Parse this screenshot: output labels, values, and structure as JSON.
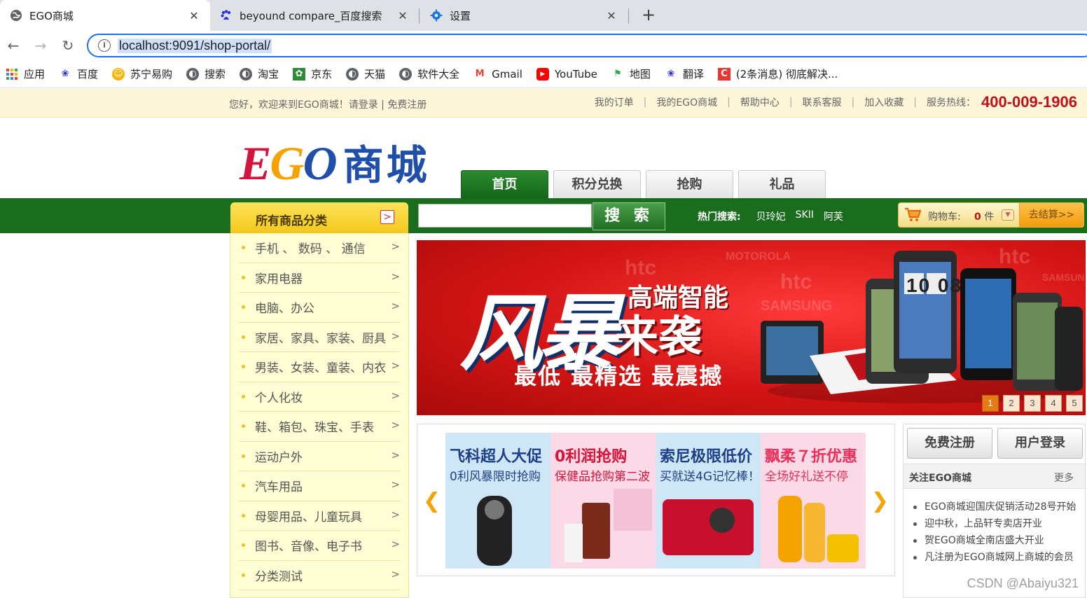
{
  "browser": {
    "tabs": [
      {
        "title": "EGO商城",
        "active": true
      },
      {
        "title": "beyound compare_百度搜索",
        "active": false
      },
      {
        "title": "设置",
        "active": false
      }
    ],
    "url": "localhost:9091/shop-portal/",
    "bookmarks": [
      "应用",
      "百度",
      "苏宁易购",
      "搜索",
      "淘宝",
      "京东",
      "天猫",
      "软件大全",
      "Gmail",
      "YouTube",
      "地图",
      "翻译",
      "(2条消息) 彻底解决..."
    ]
  },
  "topbar": {
    "welcome": "您好，欢迎来到EGO商城！请登录 | 免费注册",
    "links": [
      "我的订单",
      "我的EGO商城",
      "帮助中心",
      "联系客服",
      "加入收藏"
    ],
    "hotline_label": "服务热线：",
    "hotline_number": "400-009-1906"
  },
  "logo": {
    "latin": "EGO",
    "cn": "商城"
  },
  "main_tabs": [
    "首页",
    "积分兑换",
    "抢购",
    "礼品"
  ],
  "category_header": "所有商品分类",
  "search": {
    "button": "搜 索",
    "hot_label": "热门搜索:",
    "hot_items": [
      "贝玲妃",
      "SKII",
      "阿芙"
    ]
  },
  "cart": {
    "label": "购物车:",
    "count": "0",
    "unit": "件",
    "checkout": "去结算>>"
  },
  "categories": [
    "手机 、 数码 、 通信",
    "家用电器",
    "电脑、办公",
    "家居、家具、家装、厨具",
    "男装、女装、童装、内衣",
    "个人化妆",
    "鞋、箱包、珠宝、手表",
    "运动户外",
    "汽车用品",
    "母婴用品、儿童玩具",
    "图书、音像、电子书",
    "分类测试"
  ],
  "banner": {
    "big": "风暴",
    "line1": "高端智能",
    "line2": "来袭",
    "line3": "最低  最精选  最震撼",
    "brands": [
      "htc",
      "MOTOROLA",
      "htc",
      "SAMSUNG",
      "htc",
      "SAMSUNG"
    ],
    "phone_time": "10 08",
    "pages": [
      "1",
      "2",
      "3",
      "4",
      "5"
    ],
    "active_page": "1"
  },
  "promos": [
    {
      "t1": "飞科超人大促",
      "t2": "0利风暴限时抢购",
      "color": "#1d3f8a",
      "bg": "#cfe6f7"
    },
    {
      "t1": "0利润抢购",
      "t2": "保健品抢购第二波",
      "color": "#d4143a",
      "bg": "#fbd9e6"
    },
    {
      "t1": "索尼极限低价",
      "t2": "买就送4G记忆棒！",
      "color": "#1d3f8a",
      "bg": "#cfe6f7"
    },
    {
      "t1": "飘柔７折优惠",
      "t2": "全场好礼送不停",
      "color": "#e8305a",
      "bg": "#fbd9e6"
    }
  ],
  "side": {
    "register": "免费注册",
    "login": "用户登录",
    "news_title": "关注EGO商城",
    "news_more": "更多",
    "news": [
      "EGO商城迎国庆促销活动28号开始",
      "迎中秋，上品轩专卖店开业",
      "贺EGO商城全南店盛大开业",
      "凡注册为EGO商城网上商城的会员"
    ]
  },
  "watermark": "CSDN @Abaiyu321"
}
